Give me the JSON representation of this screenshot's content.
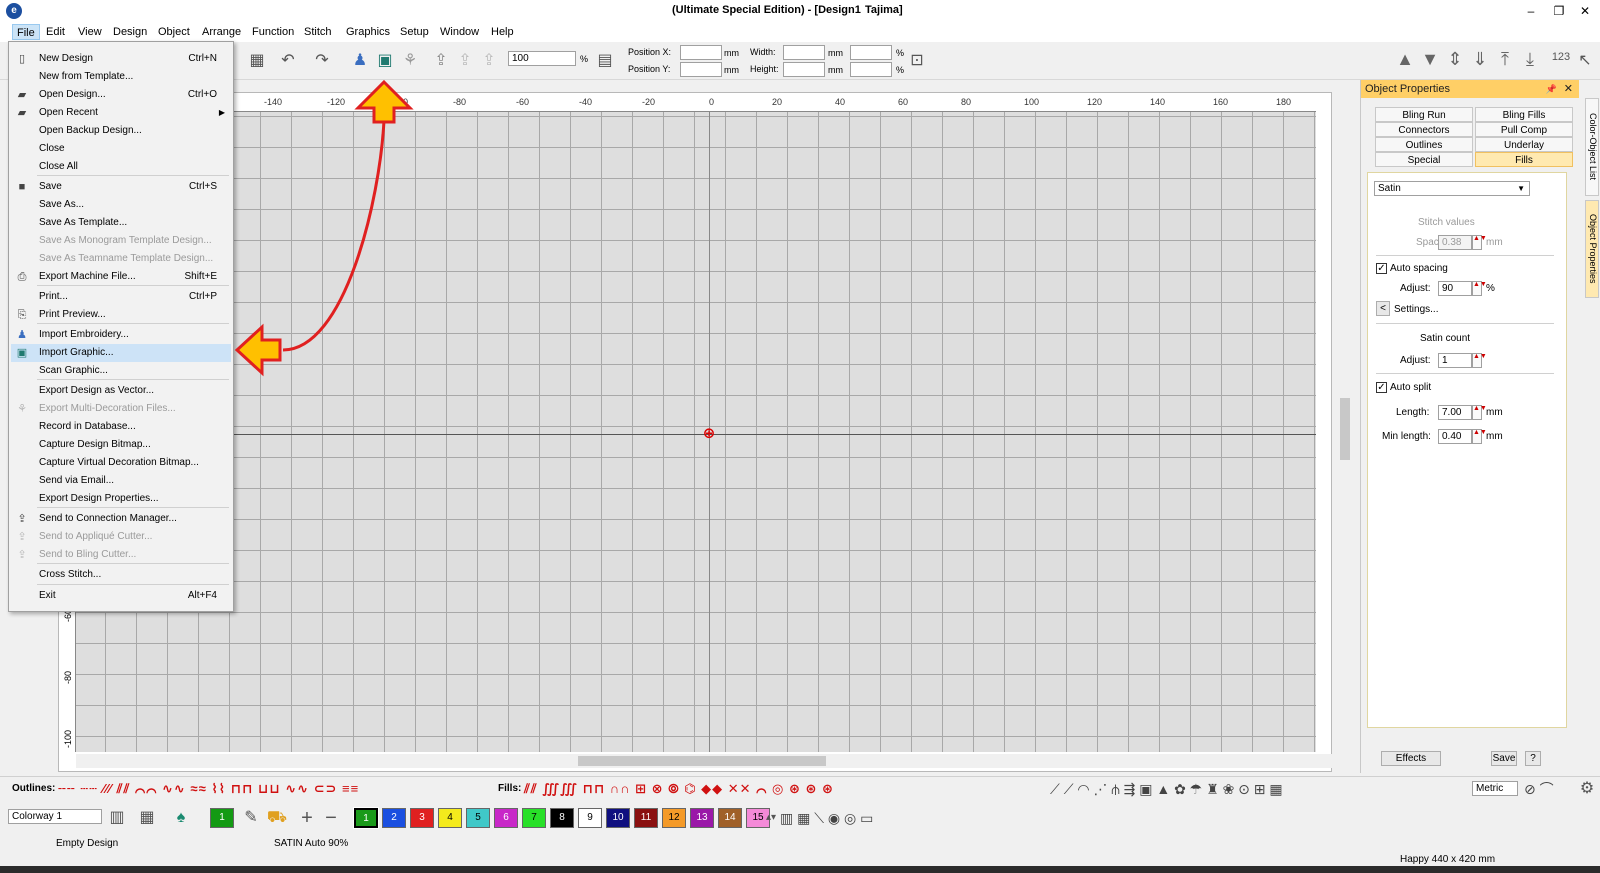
{
  "titlebar": {
    "title": "(Ultimate Special Edition) - [Design1",
    "machine": "Tajima]",
    "minimize": "–",
    "restore": "❐",
    "close": "✕"
  },
  "menubar": [
    "File",
    "Edit",
    "View",
    "Design",
    "Object",
    "Arrange",
    "Function",
    "Stitch",
    "Graphics",
    "Setup",
    "Window",
    "Help"
  ],
  "toolbar": {
    "zoom": "100",
    "zoom_unit": "%",
    "pos_x_label": "Position X:",
    "pos_y_label": "Position Y:",
    "width_label": "Width:",
    "height_label": "Height:",
    "mm": "mm",
    "pct": "%",
    "counter_label": "123"
  },
  "file_menu": [
    {
      "label": "New Design",
      "shortcut": "Ctrl+N",
      "icon": "new-doc-icon",
      "enabled": true
    },
    {
      "label": "New from Template...",
      "shortcut": "",
      "icon": "",
      "enabled": true
    },
    {
      "label": "Open Design...",
      "shortcut": "Ctrl+O",
      "icon": "open-folder-icon",
      "enabled": true
    },
    {
      "label": "Open Recent",
      "shortcut": "",
      "icon": "recent-folder-icon",
      "enabled": true,
      "submenu": true
    },
    {
      "label": "Open Backup Design...",
      "shortcut": "",
      "icon": "",
      "enabled": true
    },
    {
      "label": "Close",
      "shortcut": "",
      "icon": "",
      "enabled": true
    },
    {
      "label": "Close All",
      "shortcut": "",
      "icon": "",
      "enabled": true
    },
    {
      "label": "Save",
      "shortcut": "Ctrl+S",
      "icon": "save-disk-icon",
      "enabled": true
    },
    {
      "label": "Save As...",
      "shortcut": "",
      "icon": "",
      "enabled": true
    },
    {
      "label": "Save As Template...",
      "shortcut": "",
      "icon": "",
      "enabled": true
    },
    {
      "label": "Save As Monogram Template Design...",
      "shortcut": "",
      "icon": "",
      "enabled": false
    },
    {
      "label": "Save As Teamname Template Design...",
      "shortcut": "",
      "icon": "",
      "enabled": false
    },
    {
      "label": "Export Machine File...",
      "shortcut": "Shift+E",
      "icon": "export-machine-icon",
      "enabled": true
    },
    {
      "label": "Print...",
      "shortcut": "Ctrl+P",
      "icon": "",
      "enabled": true
    },
    {
      "label": "Print Preview...",
      "shortcut": "",
      "icon": "print-preview-icon",
      "enabled": true
    },
    {
      "label": "Import Embroidery...",
      "shortcut": "",
      "icon": "import-embroidery-icon",
      "enabled": true
    },
    {
      "label": "Import Graphic...",
      "shortcut": "",
      "icon": "import-graphic-icon",
      "enabled": true,
      "highlighted": true
    },
    {
      "label": "Scan Graphic...",
      "shortcut": "",
      "icon": "",
      "enabled": true
    },
    {
      "label": "Export Design as Vector...",
      "shortcut": "",
      "icon": "",
      "enabled": true
    },
    {
      "label": "Export Multi-Decoration Files...",
      "shortcut": "",
      "icon": "multi-decoration-icon",
      "enabled": false
    },
    {
      "label": "Record in Database...",
      "shortcut": "",
      "icon": "",
      "enabled": true
    },
    {
      "label": "Capture Design Bitmap...",
      "shortcut": "",
      "icon": "",
      "enabled": true
    },
    {
      "label": "Capture Virtual Decoration Bitmap...",
      "shortcut": "",
      "icon": "",
      "enabled": true
    },
    {
      "label": "Send via Email...",
      "shortcut": "",
      "icon": "",
      "enabled": true
    },
    {
      "label": "Export Design Properties...",
      "shortcut": "",
      "icon": "",
      "enabled": true
    },
    {
      "label": "Send to Connection Manager...",
      "shortcut": "",
      "icon": "connection-manager-icon",
      "enabled": true
    },
    {
      "label": "Send to Appliqué Cutter...",
      "shortcut": "",
      "icon": "applique-cutter-icon",
      "enabled": false
    },
    {
      "label": "Send to Bling Cutter...",
      "shortcut": "",
      "icon": "bling-cutter-icon",
      "enabled": false
    },
    {
      "label": "Cross Stitch...",
      "shortcut": "",
      "icon": "",
      "enabled": true
    },
    {
      "label": "Exit",
      "shortcut": "Alt+F4",
      "icon": "",
      "enabled": true
    }
  ],
  "ruler_top": [
    "-140",
    "-120",
    "-100",
    "-80",
    "-60",
    "-40",
    "-20",
    "0",
    "20",
    "40",
    "60",
    "80",
    "100",
    "120",
    "140",
    "160",
    "180"
  ],
  "ruler_left": [
    "-60",
    "-80",
    "-100"
  ],
  "object_properties": {
    "title": "Object Properties",
    "pin": "📌",
    "close": "✕",
    "tabs": [
      "Bling Run",
      "Bling Fills",
      "Connectors",
      "Pull Comp",
      "Outlines",
      "Underlay",
      "Special",
      "Fills"
    ],
    "active_tab": "Fills",
    "fill_type": "Satin",
    "stitch_values_label": "Stitch values",
    "spacing_label": "Spacing:",
    "spacing_value": "0.38",
    "mm": "mm",
    "auto_spacing_label": "Auto spacing",
    "auto_spacing_checked": true,
    "adjust_label": "Adjust:",
    "adjust_value": "90",
    "pct": "%",
    "settings_label": "Settings...",
    "settings_arrow": "<",
    "satin_count_label": "Satin count",
    "satin_adjust_value": "1",
    "auto_split_label": "Auto split",
    "auto_split_checked": true,
    "length_label": "Length:",
    "length_value": "7.00",
    "min_length_label": "Min length:",
    "min_length_value": "0.40",
    "effects_button": "Effects",
    "save_button": "Save",
    "help_button": "?"
  },
  "side_tabs": [
    "Color-Object List",
    "Object Properties"
  ],
  "bottom": {
    "outlines_label": "Outlines:",
    "fills_label": "Fills:",
    "units_select": "Metric",
    "colorway": "Colorway 1",
    "selected_color": "1",
    "palette": [
      {
        "n": "1",
        "color": "#1010e0"
      },
      {
        "n": "2",
        "color": "#1a4fe0"
      },
      {
        "n": "3",
        "color": "#e02020"
      },
      {
        "n": "4",
        "color": "#f4ea1c"
      },
      {
        "n": "5",
        "color": "#40c8c8"
      },
      {
        "n": "6",
        "color": "#c828c8"
      },
      {
        "n": "7",
        "color": "#28e028"
      },
      {
        "n": "8",
        "color": "#000000"
      },
      {
        "n": "9",
        "color": "#ffffff"
      },
      {
        "n": "10",
        "color": "#101080"
      },
      {
        "n": "11",
        "color": "#8a1010"
      },
      {
        "n": "12",
        "color": "#f49a28"
      },
      {
        "n": "13",
        "color": "#9a18a8"
      },
      {
        "n": "14",
        "color": "#a06028"
      },
      {
        "n": "15",
        "color": "#f48ad8"
      }
    ],
    "status_left": "Empty Design",
    "status_mid": "SATIN Auto 90%",
    "status_right": "Happy 440 x 420 mm"
  },
  "colors": {
    "accent": "#ffcf66",
    "arrow_fill": "#ffc000",
    "arrow_line": "#e02020"
  }
}
